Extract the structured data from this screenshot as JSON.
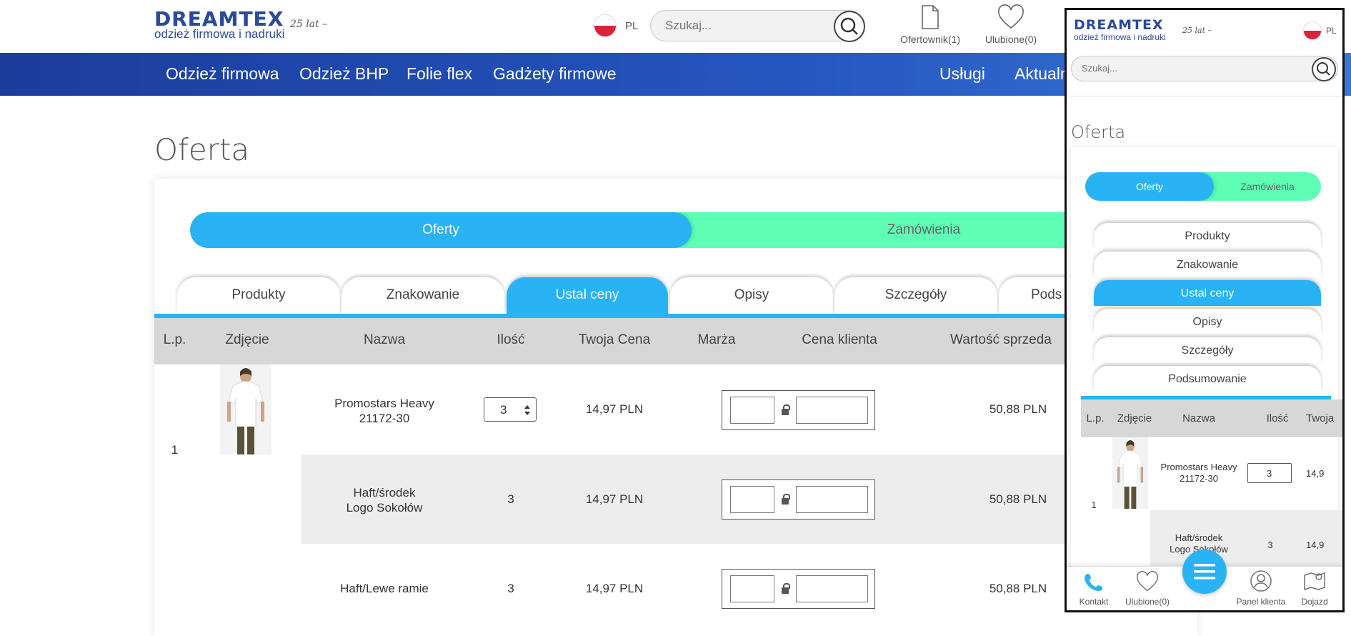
{
  "header": {
    "logo": {
      "text": "DREAMTEX",
      "tagline": "odzież firmowa i nadruki",
      "anniversary": "25 lat –"
    },
    "lang": "PL",
    "search_placeholder": "Szukaj...",
    "icons": [
      {
        "label": "Ofertownik(1)",
        "icon": "document-icon"
      },
      {
        "label": "Ulubione(0)",
        "icon": "heart-icon"
      }
    ]
  },
  "nav": {
    "left": [
      "Odzież firmowa",
      "Odzież BHP",
      "Folie flex",
      "Gadżety firmowe"
    ],
    "right": [
      "Usługi",
      "Aktualn"
    ]
  },
  "page": {
    "title": "Oferta"
  },
  "toggle": {
    "active": "Oferty",
    "inactive": "Zamówienia"
  },
  "tabs": [
    {
      "label": "Produkty",
      "active": false
    },
    {
      "label": "Znakowanie",
      "active": false
    },
    {
      "label": "Ustal ceny",
      "active": true
    },
    {
      "label": "Opisy",
      "active": false
    },
    {
      "label": "Szczegóły",
      "active": false
    },
    {
      "label": "Pods",
      "active": false
    }
  ],
  "table": {
    "headers": [
      "L.p.",
      "Zdjęcie",
      "Nazwa",
      "Ilość",
      "Twoja Cena",
      "Marża",
      "Cena klienta",
      "Wartość sprzeda"
    ],
    "row_number": "1",
    "rows": [
      {
        "name": "Promostars Heavy\n21172-30",
        "qty": "3",
        "price": "14,97 PLN",
        "value": "50,88 PLN"
      },
      {
        "name": "Haft/środek\nLogo Sokołów",
        "qty": "3",
        "price": "14,97 PLN",
        "value": "50,88 PLN"
      },
      {
        "name": "Haft/Lewe ramie",
        "qty": "3",
        "price": "14,97 PLN",
        "value": "50,88 PLN"
      }
    ]
  },
  "mobile": {
    "logo": {
      "text": "DREAMTEX",
      "tagline": "odzież firmowa i nadruki",
      "anniversary": "25 lat –"
    },
    "lang": "PL",
    "search_placeholder": "Szukaj...",
    "title": "Oferta",
    "toggle": {
      "active": "Oferty",
      "inactive": "Zamówienia"
    },
    "tabs": [
      {
        "label": "Produkty",
        "active": false
      },
      {
        "label": "Znakowanie",
        "active": false
      },
      {
        "label": "Ustal ceny",
        "active": true
      },
      {
        "label": "Opisy",
        "active": false
      },
      {
        "label": "Szczegóły",
        "active": false
      },
      {
        "label": "Podsumowanie",
        "active": false
      }
    ],
    "table_headers": [
      "L.p.",
      "Zdjęcie",
      "Nazwa",
      "Ilość",
      "Twoja"
    ],
    "row_number": "1",
    "rows": [
      {
        "name": "Promostars Heavy\n21172-30",
        "qty": "3",
        "price": "14,9"
      },
      {
        "name": "Haft/środek\nLogo Sokołów",
        "qty": "3",
        "price": "14,9"
      }
    ],
    "bottom_nav": [
      {
        "label": "Kontakt",
        "icon": "phone-icon"
      },
      {
        "label": "Ulubione(0)",
        "icon": "heart-icon"
      },
      {
        "label": "",
        "icon": "menu-icon"
      },
      {
        "label": "Panel klienta",
        "icon": "user-icon"
      },
      {
        "label": "Dojazd",
        "icon": "map-icon"
      }
    ]
  },
  "colors": {
    "accent_blue": "#29b3f5",
    "accent_green": "#5effb4",
    "nav_blue": "#1c3c9c"
  }
}
